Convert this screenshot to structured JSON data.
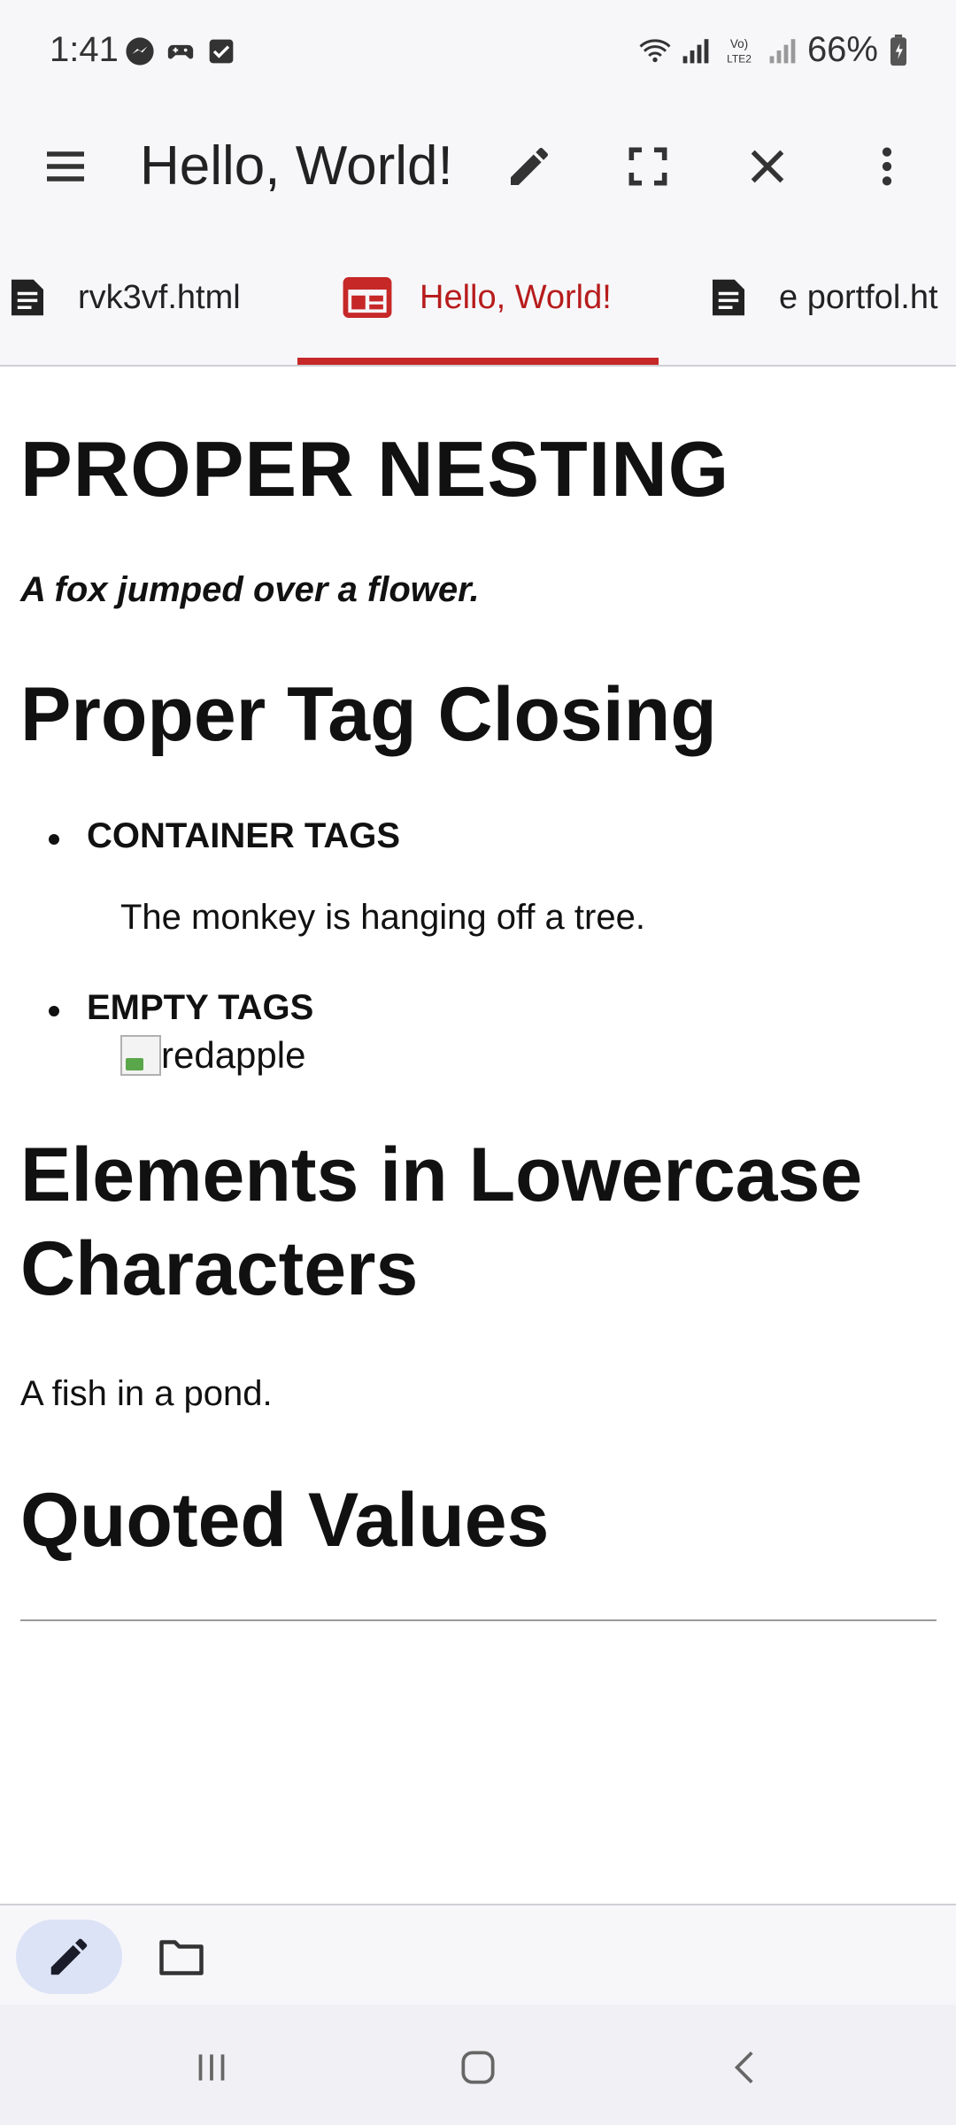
{
  "status_bar": {
    "time": "1:41",
    "battery": "66%",
    "icons": [
      "messenger-icon",
      "game-controller-icon",
      "checkbox-icon",
      "wifi-icon",
      "signal-icon",
      "volte-icon",
      "signal-icon-2",
      "battery-icon"
    ]
  },
  "app_bar": {
    "title": "Hello, World!",
    "icons": [
      "menu-icon",
      "edit-icon",
      "fullscreen-icon",
      "close-icon",
      "more-vert-icon"
    ]
  },
  "tabs": [
    {
      "label": "rvk3vf.html",
      "icon": "document-icon",
      "active": false
    },
    {
      "label": "Hello, World!",
      "icon": "web-preview-icon",
      "active": true
    },
    {
      "label": "e portfol.ht",
      "icon": "document-icon",
      "active": false
    }
  ],
  "content": {
    "heading1": "PROPER NESTING",
    "fox": "A fox jumped over a flower.",
    "heading_closing": "Proper Tag Closing",
    "bullet1": "CONTAINER TAGS",
    "monkey": "The monkey is hanging off a tree.",
    "bullet2": "EMPTY TAGS",
    "img_alt": "redapple",
    "heading_lower": "Elements in Lowercase Characters",
    "fish": "A fish in a pond.",
    "heading_quoted": "Quoted Values"
  },
  "colors": {
    "accent": "#c62828",
    "bar_bg": "#f7f7fa",
    "pill_bg": "#dde3f6"
  }
}
